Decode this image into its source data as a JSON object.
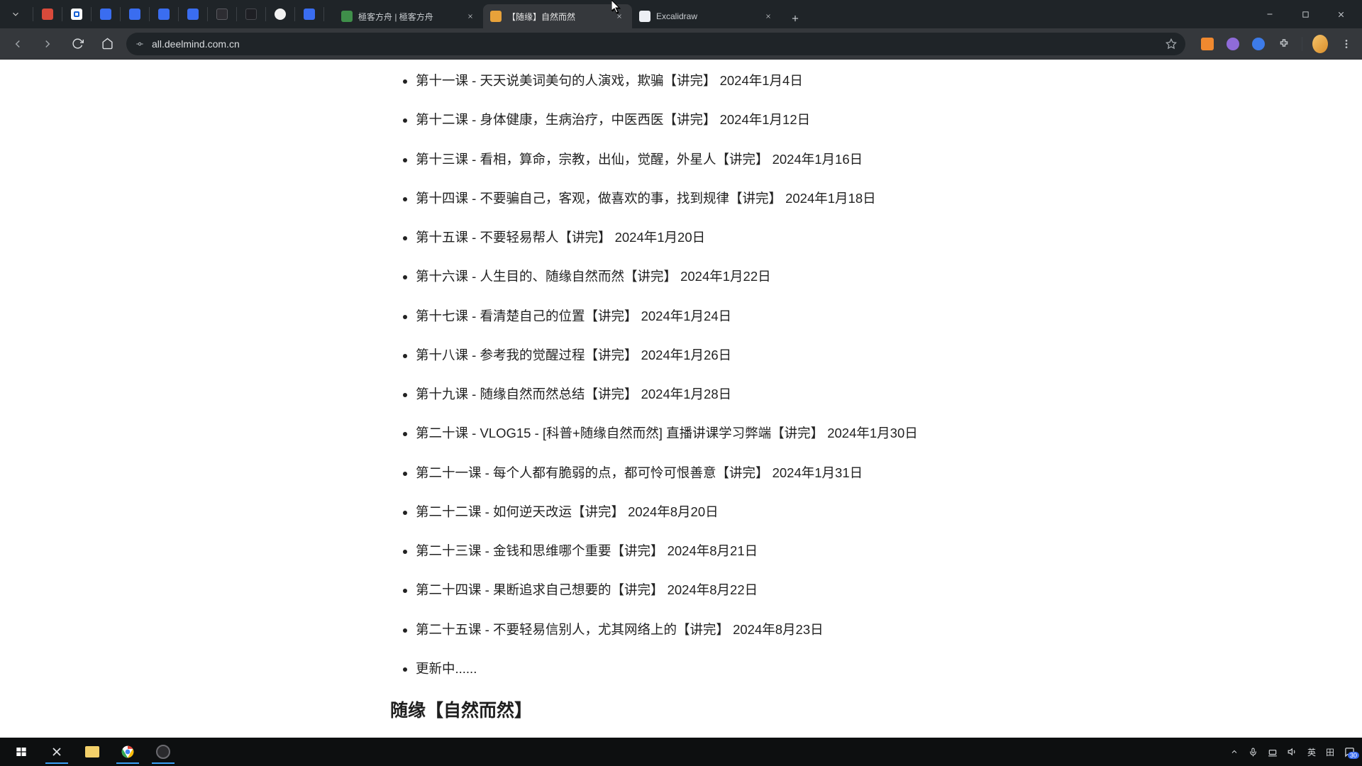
{
  "titlebar": {
    "tabs": [
      {
        "title": "極客方舟 | 極客方舟",
        "favicon_bg": "#3f8f4a",
        "favicon_text": ""
      },
      {
        "title": "【随缘】自然而然",
        "favicon_bg": "#e8a23a",
        "favicon_text": ""
      },
      {
        "title": "Excalidraw",
        "favicon_bg": "#eceff4",
        "favicon_text": ""
      }
    ],
    "active_index": 1
  },
  "toolbar": {
    "url": "all.deelmind.com.cn"
  },
  "page": {
    "lessons": [
      "第十一课 - 天天说美词美句的人演戏，欺骗【讲完】 2024年1月4日",
      "第十二课 - 身体健康，生病治疗，中医西医【讲完】 2024年1月12日",
      "第十三课 - 看相，算命，宗教，出仙，觉醒，外星人【讲完】 2024年1月16日",
      "第十四课 - 不要骗自己，客观，做喜欢的事，找到规律【讲完】 2024年1月18日",
      "第十五课 - 不要轻易帮人【讲完】 2024年1月20日",
      "第十六课 - 人生目的、随缘自然而然【讲完】 2024年1月22日",
      "第十七课 - 看清楚自己的位置【讲完】 2024年1月24日",
      "第十八课 - 参考我的觉醒过程【讲完】 2024年1月26日",
      "第十九课 - 随缘自然而然总结【讲完】 2024年1月28日",
      "第二十课 - VLOG15 - [科普+随缘自然而然] 直播讲课学习弊端【讲完】 2024年1月30日",
      "第二十一课 - 每个人都有脆弱的点，都可怜可恨善意【讲完】 2024年1月31日",
      "第二十二课 - 如何逆天改运【讲完】 2024年8月20日",
      "第二十三课 - 金钱和思维哪个重要【讲完】 2024年8月21日",
      "第二十四课 - 果断追求自己想要的【讲完】 2024年8月22日",
      "第二十五课 - 不要轻易信别人，尤其网络上的【讲完】 2024年8月23日",
      "更新中......"
    ],
    "heading": "随缘【自然而然】"
  },
  "taskbar": {
    "ime": "英",
    "ime2": "田",
    "notification_count": "30"
  }
}
